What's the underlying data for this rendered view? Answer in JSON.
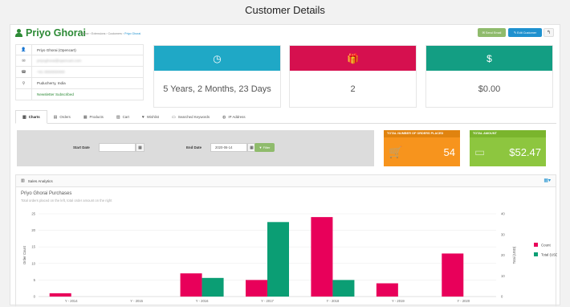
{
  "page_title": "Customer Details",
  "header": {
    "customer_name": "Priyo Ghorai",
    "breadcrumbs": [
      "Home",
      "Extensions",
      "Customers",
      "Priyo Ghorai"
    ],
    "buttons": {
      "send_email": "Send Email",
      "edit_customer": "Edit Customer",
      "back": "↰"
    }
  },
  "info": [
    {
      "icon": "user-icon",
      "glyph": "👤",
      "text": "Priyo Ghorai (Opencart)",
      "blurred": false,
      "green": false
    },
    {
      "icon": "envelope-icon",
      "glyph": "✉",
      "text": "priyoghorai@opencart.com",
      "blurred": true,
      "green": false
    },
    {
      "icon": "phone-icon",
      "glyph": "☎",
      "text": "+91 0000000000",
      "blurred": true,
      "green": false
    },
    {
      "icon": "map-marker-icon",
      "glyph": "⚲",
      "text": "Puducherry, India",
      "blurred": false,
      "green": false
    },
    {
      "icon": "newsletter-icon",
      "glyph": "",
      "text": "Newsletter Subscribed",
      "blurred": false,
      "green": true
    }
  ],
  "stats": [
    {
      "icon": "clock-icon",
      "glyph": "◷",
      "value": "5 Years, 2 Months, 23 Days",
      "color": "#1fa8c6"
    },
    {
      "icon": "gift-icon",
      "glyph": "🎁",
      "value": "2",
      "color": "#d6104f"
    },
    {
      "icon": "dollar-icon",
      "glyph": "$",
      "value": "$0.00",
      "color": "#139e83"
    }
  ],
  "tabs": [
    {
      "label": "Charts",
      "icon": "bar-chart-icon",
      "glyph": "▥",
      "active": true
    },
    {
      "label": "Orders",
      "icon": "cart-icon",
      "glyph": "▤",
      "active": false
    },
    {
      "label": "Products",
      "icon": "box-icon",
      "glyph": "▦",
      "active": false
    },
    {
      "label": "Cart",
      "icon": "shopping-cart-icon",
      "glyph": "▨",
      "active": false
    },
    {
      "label": "Wishlist",
      "icon": "heart-icon",
      "glyph": "♥",
      "active": false
    },
    {
      "label": "Searched Keywords",
      "icon": "search-list-icon",
      "glyph": "▭",
      "active": false
    },
    {
      "label": "IP Address",
      "icon": "globe-icon",
      "glyph": "◍",
      "active": false
    }
  ],
  "filter": {
    "start_label": "Start Date",
    "start_value": "",
    "end_label": "End Date",
    "end_value": "2020-06-14",
    "filter_button": "▼ Filter"
  },
  "totals": [
    {
      "title": "TOTAL NUMBER OF ORDERS PLACED",
      "value": "54",
      "icon": "shopping-cart-icon"
    },
    {
      "title": "TOTAL AMOUNT",
      "value": "$52.47",
      "icon": "credit-card-icon"
    }
  ],
  "analytics": {
    "header": "Sales Analytics",
    "chart_title": "Priyo Ghorai Purchases",
    "chart_subtitle": "Total orders placed on the left, total order amount on the right"
  },
  "chart_data": {
    "type": "bar",
    "categories": [
      "Y - 2014",
      "Y - 2015",
      "Y - 2016",
      "Y - 2017",
      "Y - 2018",
      "Y - 2019",
      "Y - 2020"
    ],
    "series": [
      {
        "name": "Count",
        "axis": "left",
        "color": "#e8005a",
        "values": [
          1,
          0,
          7,
          5,
          24,
          4,
          13
        ]
      },
      {
        "name": "Total (USD)",
        "axis": "right",
        "color": "#0b9e74",
        "values": [
          0,
          0,
          9,
          36,
          8,
          0,
          0
        ]
      }
    ],
    "ylabel": "Order Count",
    "ylabel_right": "Total (USD)",
    "ylim": [
      0,
      25
    ],
    "yticks": [
      0,
      5,
      10,
      15,
      20,
      25
    ],
    "ylim_right": [
      0,
      40
    ],
    "yticks_right": [
      0,
      10,
      20,
      30,
      40
    ],
    "legend": "top-right"
  }
}
